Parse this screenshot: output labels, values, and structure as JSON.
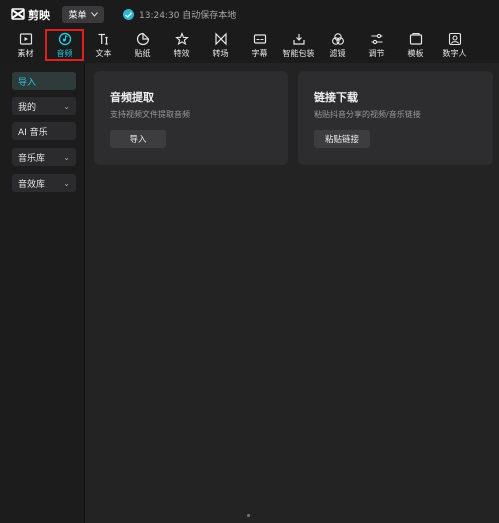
{
  "app": {
    "name": "剪映",
    "menu_label": "菜单",
    "save_status": "13:24:30 自动保存本地"
  },
  "toolbar": {
    "items": [
      {
        "label": "素材",
        "icon": "media-icon"
      },
      {
        "label": "音频",
        "icon": "audio-icon",
        "active": true
      },
      {
        "label": "文本",
        "icon": "text-icon"
      },
      {
        "label": "贴纸",
        "icon": "sticker-icon"
      },
      {
        "label": "特效",
        "icon": "effects-icon"
      },
      {
        "label": "转场",
        "icon": "transition-icon"
      },
      {
        "label": "字幕",
        "icon": "subtitle-icon"
      },
      {
        "label": "智能包装",
        "icon": "smart-pack-icon"
      },
      {
        "label": "滤镜",
        "icon": "filter-icon"
      },
      {
        "label": "调节",
        "icon": "adjust-icon"
      },
      {
        "label": "模板",
        "icon": "template-icon"
      },
      {
        "label": "数字人",
        "icon": "digital-human-icon"
      }
    ]
  },
  "sidebar": {
    "items": [
      {
        "label": "导入",
        "active": true
      },
      {
        "label": "我的",
        "dropdown": true
      },
      {
        "label": "AI 音乐"
      },
      {
        "label": "音乐库",
        "dropdown": true
      },
      {
        "label": "音效库",
        "dropdown": true
      }
    ]
  },
  "cards": {
    "extract": {
      "title": "音频提取",
      "desc": "支持视频文件提取音频",
      "button": "导入"
    },
    "download": {
      "title": "链接下载",
      "desc": "粘贴抖音分享的视频/音乐链接",
      "button": "粘贴链接"
    }
  },
  "colors": {
    "accent": "#2bc4d9",
    "highlight_border": "#e02020"
  }
}
